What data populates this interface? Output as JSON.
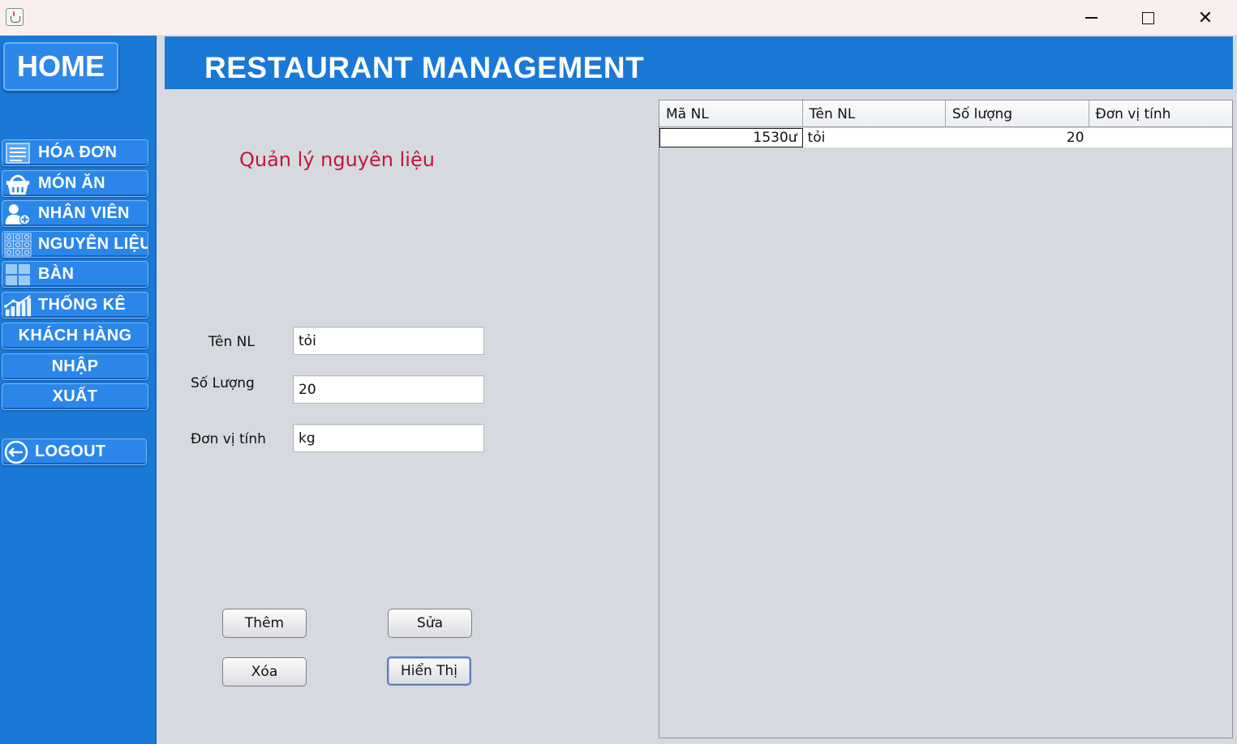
{
  "window": {
    "close_glyph": "✕"
  },
  "sidebar": {
    "home_label": "HOME",
    "items": [
      {
        "label": "HÓA ĐƠN",
        "icon": "invoice-list-icon"
      },
      {
        "label": "MÓN ĂN",
        "icon": "basket-icon"
      },
      {
        "label": "NHÂN VIÊN",
        "icon": "add-user-icon"
      },
      {
        "label": "NGUYÊN LIỆU",
        "icon": "grid-ingredients-icon"
      },
      {
        "label": "BÀN",
        "icon": "table-grid-icon"
      },
      {
        "label": "THỐNG KÊ",
        "icon": "bar-chart-icon"
      },
      {
        "label": "KHÁCH HÀNG"
      },
      {
        "label": "NHẬP"
      },
      {
        "label": "XUẤT"
      }
    ],
    "logout_label": "LOGOUT"
  },
  "header": {
    "title": "RESTAURANT MANAGEMENT"
  },
  "form": {
    "title": "Quản lý nguyên liệu",
    "name_label": "Tên NL",
    "name_value": "tỏi",
    "qty_label": "Số Lượng",
    "qty_value": "20",
    "unit_label": "Đơn vị tính",
    "unit_value": "kg"
  },
  "buttons": {
    "add": "Thêm",
    "edit": "Sửa",
    "delete": "Xóa",
    "show": "Hiển Thị"
  },
  "table": {
    "columns": [
      "Mã NL",
      "Tên NL",
      "Số lượng",
      "Đơn vị tính"
    ],
    "rows": [
      {
        "id": "1530ư",
        "name": "tỏi",
        "qty": "20",
        "unit": ""
      }
    ]
  },
  "colors": {
    "accent": "#1a78d6",
    "title_red": "#c4163b",
    "background": "#d6d9e0"
  }
}
